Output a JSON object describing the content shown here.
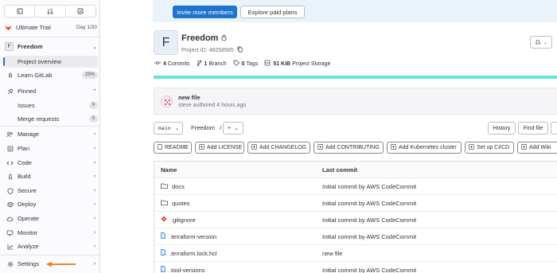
{
  "sidebar": {
    "top_icons": [
      "issues-icon",
      "merge-requests-icon",
      "todo-icon"
    ],
    "trial": {
      "label": "Ultimate Trial",
      "day": "Day 1/30"
    },
    "project": {
      "initial": "F",
      "name": "Freedom"
    },
    "items": [
      {
        "label": "Project overview",
        "icon": "project-icon",
        "active": true
      },
      {
        "label": "Learn GitLab",
        "icon": "rocket-icon",
        "badge": "25%"
      },
      {
        "label": "Pinned",
        "icon": "pin-icon",
        "chevron": "^"
      },
      {
        "label": "Manage",
        "icon": "users-icon",
        "chevron": ">"
      },
      {
        "label": "Plan",
        "icon": "plan-icon",
        "chevron": ">"
      },
      {
        "label": "Code",
        "icon": "code-icon",
        "chevron": ">"
      },
      {
        "label": "Build",
        "icon": "rocket-icon",
        "chevron": ">"
      },
      {
        "label": "Secure",
        "icon": "shield-icon",
        "chevron": ">"
      },
      {
        "label": "Deploy",
        "icon": "deploy-icon",
        "chevron": ">"
      },
      {
        "label": "Operate",
        "icon": "cloud-icon",
        "chevron": ">"
      },
      {
        "label": "Monitor",
        "icon": "monitor-icon",
        "chevron": ">"
      },
      {
        "label": "Analyze",
        "icon": "chart-icon",
        "chevron": ">"
      },
      {
        "label": "Settings",
        "icon": "gear-icon",
        "chevron": ">"
      }
    ],
    "pinned": [
      {
        "label": "Issues",
        "count": "0"
      },
      {
        "label": "Merge requests",
        "count": "0"
      }
    ]
  },
  "banner": {
    "invite_label": "Invite more members",
    "explore_label": "Explore paid plans"
  },
  "project": {
    "avatar_letter": "F",
    "title": "Freedom",
    "id_text": "Project ID: 48258585",
    "stats": [
      {
        "value": "4",
        "label": "Commits"
      },
      {
        "value": "1",
        "label": "Branch"
      },
      {
        "value": "0",
        "label": "Tags"
      },
      {
        "value": "51 KiB",
        "label": "Project Storage"
      }
    ]
  },
  "commit": {
    "title": "new file",
    "meta": "steve authored 4 hours ago"
  },
  "toolbar": {
    "branch": "main",
    "path": "Freedom",
    "slash": "/",
    "add": "+",
    "history": "History",
    "find_file": "Find file"
  },
  "quick_buttons": [
    "README",
    "Add LICENSE",
    "Add CHANGELOG",
    "Add CONTRIBUTING",
    "Add Kubernetes cluster",
    "Set up CI/CD",
    "Add Wiki"
  ],
  "files": {
    "headers": {
      "name": "Name",
      "commit": "Last commit"
    },
    "rows": [
      {
        "name": "docs",
        "icon": "folder-icon",
        "commit": "Initial commit by AWS CodeCommit"
      },
      {
        "name": "quotes",
        "icon": "folder-icon",
        "commit": "Initial commit by AWS CodeCommit"
      },
      {
        "name": ".gitignore",
        "icon": "git-icon",
        "commit": "Initial commit by AWS CodeCommit"
      },
      {
        "name": ".terraform-version",
        "icon": "file-icon",
        "commit": "Initial commit by AWS CodeCommit"
      },
      {
        "name": ".terraform.lock.hcl",
        "icon": "file-icon",
        "commit": "new file"
      },
      {
        "name": ".tool-versions",
        "icon": "file-icon",
        "commit": "Initial commit by AWS CodeCommit"
      }
    ]
  },
  "colors": {
    "primary": "#1f75cb",
    "progress": "#63e6e2",
    "arrow": "#e8832d"
  }
}
